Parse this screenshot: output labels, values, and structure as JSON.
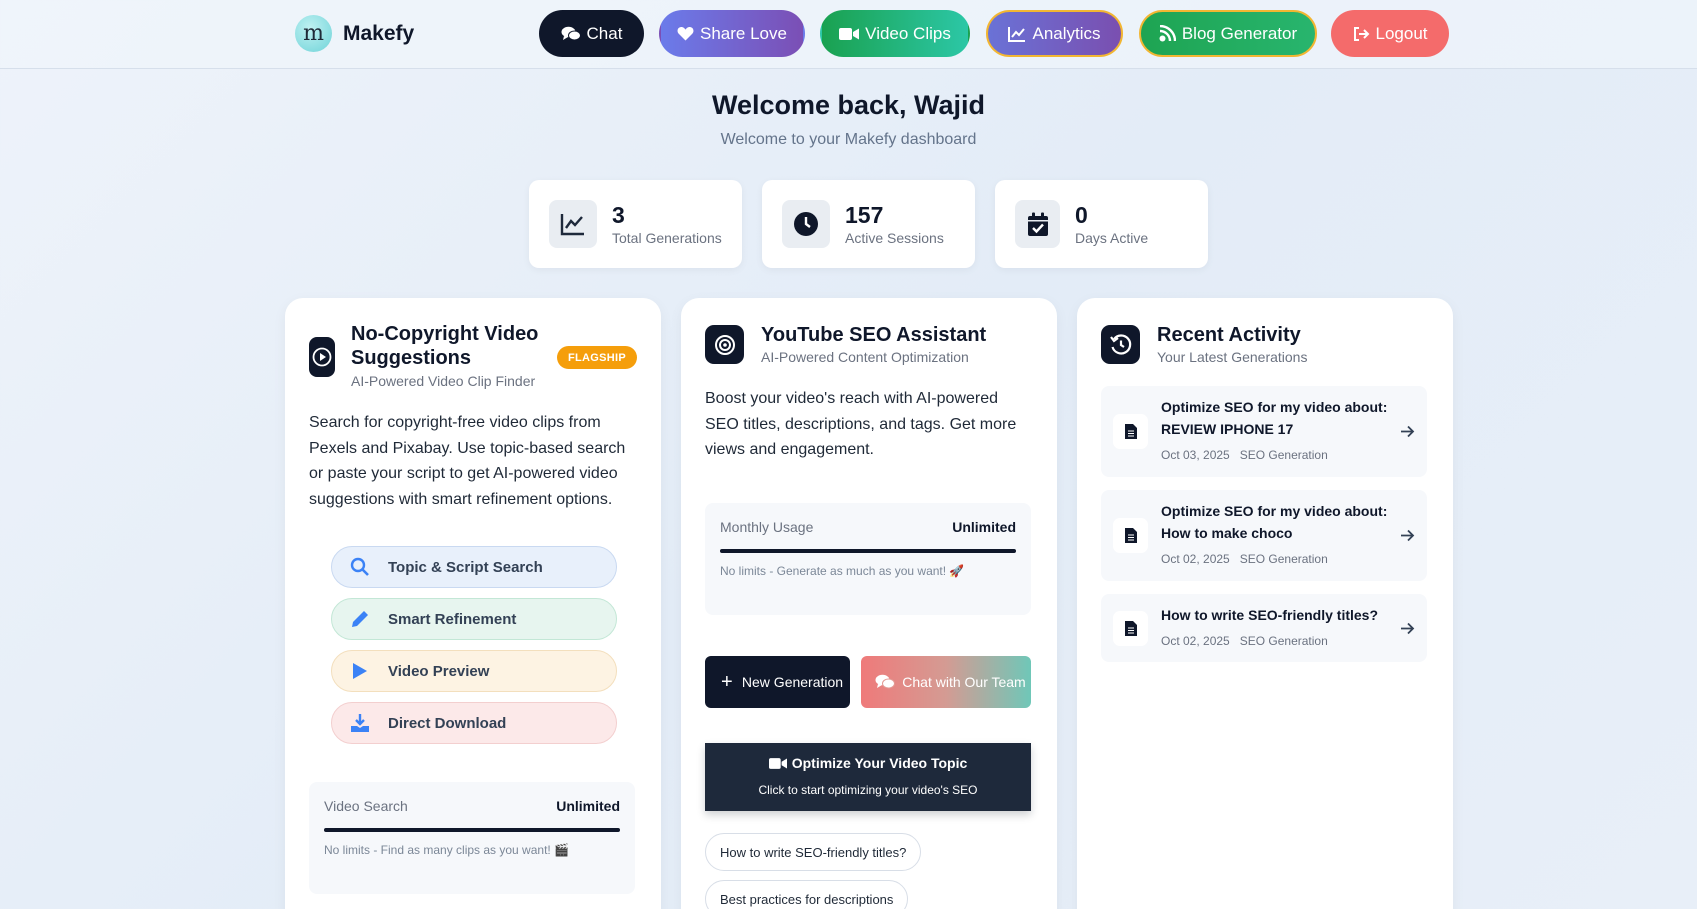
{
  "brand": {
    "name": "Makefy",
    "logo_glyph": "m"
  },
  "nav": {
    "chat": "Chat",
    "share_love": "Share Love",
    "video_clips": "Video Clips",
    "analytics": "Analytics",
    "blog_generator": "Blog Generator",
    "logout": "Logout"
  },
  "header": {
    "title": "Welcome back, Wajid",
    "subtitle": "Welcome to your Makefy dashboard"
  },
  "stats": [
    {
      "value": "3",
      "label": "Total Generations",
      "icon": "chart-line-icon"
    },
    {
      "value": "157",
      "label": "Active Sessions",
      "icon": "clock-icon"
    },
    {
      "value": "0",
      "label": "Days Active",
      "icon": "calendar-check-icon"
    }
  ],
  "video_card": {
    "title": "No-Copyright Video Suggestions",
    "subtitle": "AI-Powered Video Clip Finder",
    "badge": "FLAGSHIP",
    "description": "Search for copyright-free video clips from Pexels and Pixabay. Use topic-based search or paste your script to get AI-powered video suggestions with smart refinement options.",
    "features": [
      {
        "label": "Topic & Script Search",
        "icon": "search-icon"
      },
      {
        "label": "Smart Refinement",
        "icon": "pencil-icon"
      },
      {
        "label": "Video Preview",
        "icon": "play-icon"
      },
      {
        "label": "Direct Download",
        "icon": "download-icon"
      }
    ],
    "usage": {
      "label": "Video Search",
      "value": "Unlimited",
      "note": "No limits - Find as many clips as you want! 🎬",
      "progress": 1.0
    }
  },
  "seo_card": {
    "title": "YouTube SEO Assistant",
    "subtitle": "AI-Powered Content Optimization",
    "description": "Boost your video's reach with AI-powered SEO titles, descriptions, and tags. Get more views and engagement.",
    "usage": {
      "label": "Monthly Usage",
      "value": "Unlimited",
      "note": "No limits - Generate as much as you want! 🚀",
      "progress": 1.0
    },
    "new_generation": "New Generation",
    "chat_team": "Chat with Our Team",
    "optimize_title": "Optimize Your Video Topic",
    "optimize_sub": "Click to start optimizing your video's SEO",
    "suggestions": [
      "How to write SEO-friendly titles?",
      "Best practices for descriptions"
    ]
  },
  "activity_card": {
    "title": "Recent Activity",
    "subtitle": "Your Latest Generations",
    "items": [
      {
        "title": "Optimize SEO for my video about: REVIEW IPHONE 17",
        "date": "Oct 03, 2025",
        "type": "SEO Generation"
      },
      {
        "title": "Optimize SEO for my video about: How to make choco",
        "date": "Oct 02, 2025",
        "type": "SEO Generation"
      },
      {
        "title": "How to write SEO-friendly titles?",
        "date": "Oct 02, 2025",
        "type": "SEO Generation"
      }
    ]
  },
  "colors": {
    "primary_dark": "#0f172a",
    "flagship_badge": "#f59e0b",
    "logout": "#f46b6b",
    "feature_icon_blue": "#3b82f6"
  }
}
